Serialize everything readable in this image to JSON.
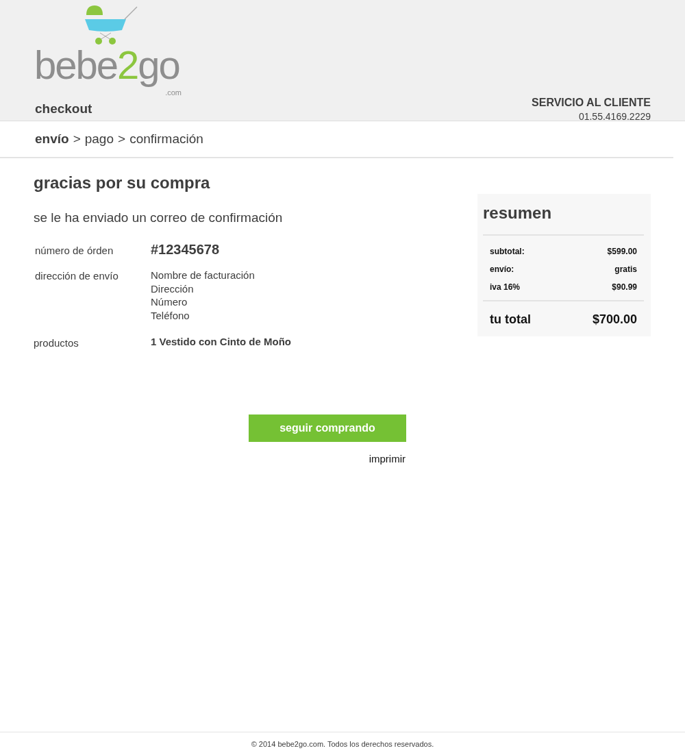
{
  "header": {
    "logo": {
      "parts": [
        "bebe",
        "2",
        "go"
      ],
      "suffix": ".com"
    },
    "title": "checkout",
    "service": {
      "label": "SERVICIO AL CLIENTE",
      "phone": "01.55.4169.2229"
    }
  },
  "breadcrumb": {
    "separator": ">",
    "steps": [
      {
        "label": "envío",
        "selected": true
      },
      {
        "label": "pago",
        "selected": false
      },
      {
        "label": "confirmación",
        "selected": false
      }
    ]
  },
  "confirmation": {
    "title": "gracias por su compra",
    "message": "se le ha enviado un correo de confirmación",
    "details": [
      {
        "label": "número de órden",
        "kind": "order",
        "lines": [
          "#12345678"
        ]
      },
      {
        "label": "dirección de envío",
        "kind": "address",
        "lines": [
          "Nombre de facturación",
          "Dirección",
          "Número",
          "Teléfono"
        ]
      },
      {
        "label": "productos",
        "kind": "product",
        "lines": [
          "1 Vestido con Cinto de Moño"
        ]
      }
    ]
  },
  "summary": {
    "title": "resumen",
    "rows": [
      {
        "label": "subtotal:",
        "value": "$599.00"
      },
      {
        "label": "envío:",
        "value": "gratis"
      },
      {
        "label": "iva 16%",
        "value": "$90.99"
      }
    ],
    "total": {
      "label": "tu total",
      "value": "$700.00"
    }
  },
  "actions": {
    "primary": "seguir comprando",
    "link": "imprimir"
  },
  "footer": "© 2014 bebe2go.com. Todos los derechos reservados."
}
